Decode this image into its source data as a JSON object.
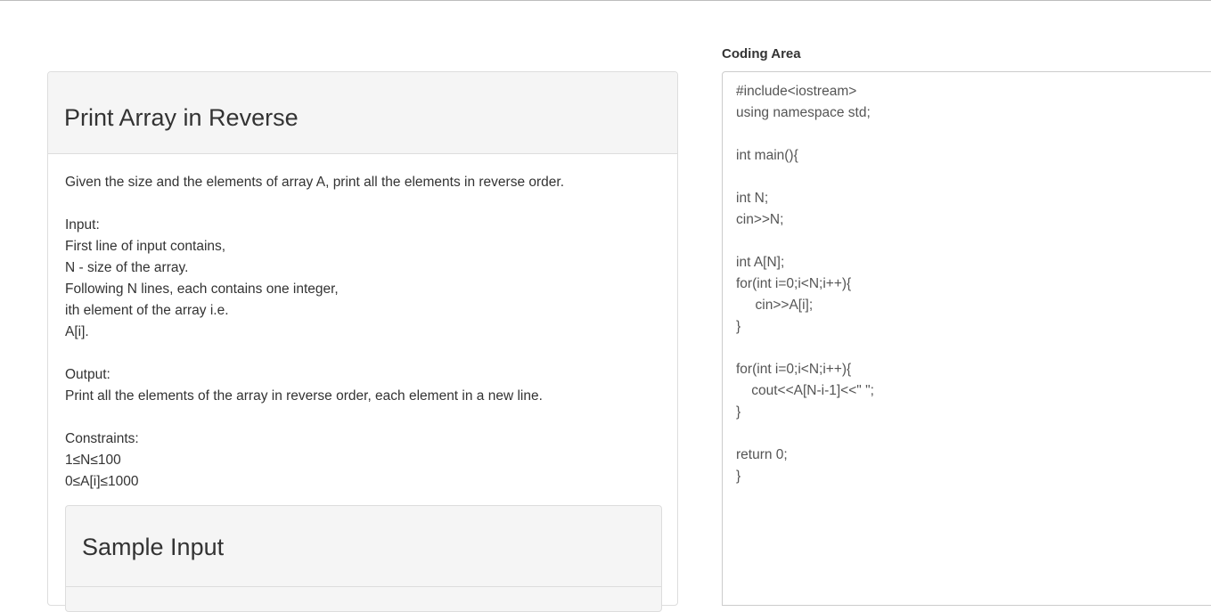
{
  "problem": {
    "title": "Print Array in Reverse",
    "statement": "Given the size and the elements of array A, print all the elements in reverse order.\n\nInput:\nFirst line of input contains,\nN - size of the array.\nFollowing N lines, each contains one integer,\nith element of the array i.e.\nA[i].\n\nOutput:\nPrint all the elements of the array in reverse order, each element in a new line.\n\nConstraints:\n1≤N≤100\n0≤A[i]≤1000",
    "sample_input_heading": "Sample Input"
  },
  "coding_area": {
    "label": "Coding Area",
    "code": "#include<iostream>\nusing namespace std;\n\nint main(){\n\nint N;\ncin>>N;\n\nint A[N];\nfor(int i=0;i<N;i++){\n     cin>>A[i];\n}\n\nfor(int i=0;i<N;i++){\n    cout<<A[N-i-1]<<\" \";\n}\n\nreturn 0;\n}"
  }
}
